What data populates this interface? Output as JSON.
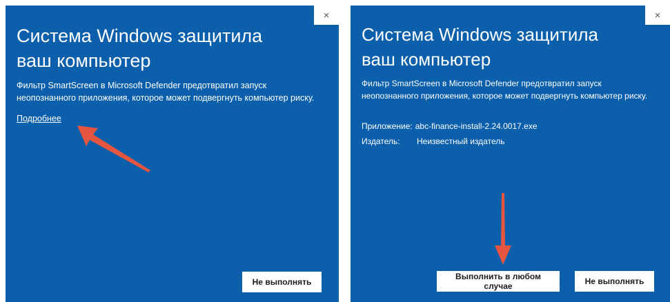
{
  "left_dialog": {
    "close_glyph": "×",
    "title": "Система Windows защитила ваш компьютер",
    "description": "Фильтр SmartScreen в Microsoft Defender предотвратил запуск неопознанного приложения, которое может подвергнуть компьютер риску.",
    "more_link": "Подробнее",
    "dont_run_label": "Не выполнять"
  },
  "right_dialog": {
    "close_glyph": "×",
    "title": "Система Windows защитила ваш компьютер",
    "description": "Фильтр SmartScreen в Microsoft Defender предотвратил запуск неопознанного приложения, которое может подвергнуть компьютер риску.",
    "app_label": "Приложение:",
    "app_value": "abc-finance-install-2.24.0017.exe",
    "publisher_label": "Издатель:",
    "publisher_value": "Неизвестный издатель",
    "run_anyway_label": "Выполнить в любом случае",
    "dont_run_label": "Не выполнять"
  },
  "colors": {
    "dialog_background": "#0b5fab",
    "button_background": "#ffffff",
    "annotation_arrow": "#e5553f"
  },
  "annotations": {
    "left_arrow_icon": "red-arrow-pointing-up-left",
    "right_arrow_icon": "red-arrow-pointing-down"
  }
}
